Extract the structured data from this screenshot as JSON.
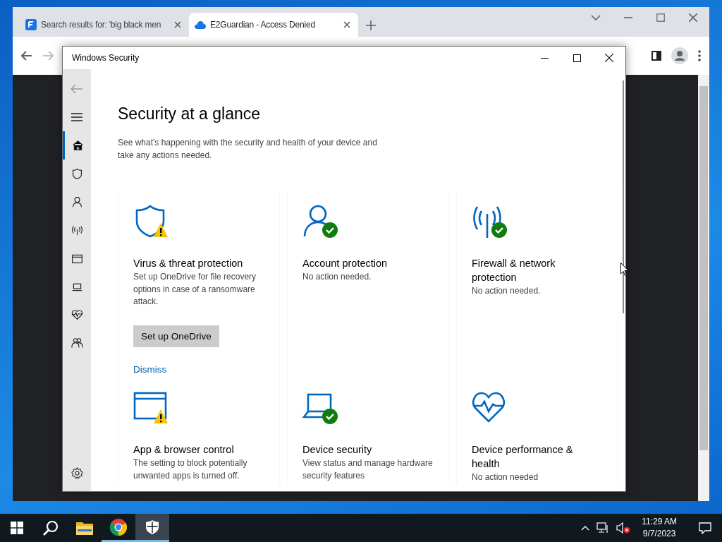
{
  "browser": {
    "tabs": [
      {
        "label": "Search results for: 'big black men",
        "selected": false
      },
      {
        "label": "E2Guardian - Access Denied",
        "selected": true
      }
    ]
  },
  "security_window": {
    "title": "Windows Security",
    "sidebar": {
      "items": [
        {
          "selected": true
        },
        {
          "selected": false
        },
        {
          "selected": false
        },
        {
          "selected": false
        },
        {
          "selected": false
        },
        {
          "selected": false
        },
        {
          "selected": false
        },
        {
          "selected": false
        }
      ]
    },
    "heading": "Security at a glance",
    "subtitle": "See what's happening with the security and health of your device and take any actions needed.",
    "cards": [
      {
        "title": "Virus & threat protection",
        "description": "Set up OneDrive for file recovery options in case of a ransomware attack.",
        "warning": true,
        "ok": false,
        "button": "Set up OneDrive",
        "link": "Dismiss"
      },
      {
        "title": "Account protection",
        "description": "No action needed.",
        "warning": false,
        "ok": true
      },
      {
        "title": "Firewall & network protection",
        "description": "No action needed.",
        "warning": false,
        "ok": true
      },
      {
        "title": "App & browser control",
        "description": "The setting to block potentially unwanted apps is turned off.",
        "warning": true,
        "ok": false
      },
      {
        "title": "Device security",
        "description": "View status and manage hardware security features",
        "warning": false,
        "ok": true
      },
      {
        "title": "Device performance & health",
        "description": "No action needed",
        "warning": false,
        "ok": false
      }
    ]
  },
  "taskbar": {
    "apps": [
      {
        "running": false,
        "selected": false
      },
      {
        "running": true,
        "selected": false
      },
      {
        "running": true,
        "selected": true
      }
    ],
    "time": "11:29 AM",
    "date": "9/7/2023"
  }
}
